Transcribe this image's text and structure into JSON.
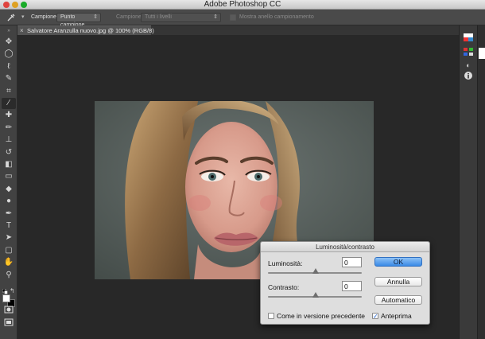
{
  "app": {
    "title": "Adobe Photoshop CC"
  },
  "options_bar": {
    "sample_label": "Campione:",
    "sample_value": "Punto campione",
    "sample_label2": "Campione:",
    "sample_value2": "Tutti i livelli",
    "show_ring_label": "Mostra anello campionamento"
  },
  "document": {
    "tab_title": "Salvatore Aranzulla nuovo.jpg @ 100% (RGB/8)",
    "close_glyph": "×"
  },
  "dialog": {
    "title": "Luminosità/contrasto",
    "brightness_label": "Luminosità:",
    "brightness_value": "0",
    "contrast_label": "Contrasto:",
    "contrast_value": "0",
    "ok_label": "OK",
    "cancel_label": "Annulla",
    "auto_label": "Automatico",
    "legacy_label": "Come in versione precedente",
    "preview_label": "Anteprima",
    "legacy_checked": false,
    "preview_checked": true
  },
  "colors": {
    "accent": "#3a8ae6",
    "workspace": "#282828",
    "panel": "#424242"
  },
  "tools": [
    "move-icon",
    "marquee-icon",
    "lasso-icon",
    "quick-select-icon",
    "crop-icon",
    "eyedropper-icon",
    "healing-icon",
    "brush-icon",
    "stamp-icon",
    "history-brush-icon",
    "eraser-icon",
    "gradient-icon",
    "blur-icon",
    "dodge-icon",
    "pen-icon",
    "type-icon",
    "path-select-icon",
    "shape-icon",
    "hand-icon",
    "zoom-icon"
  ]
}
